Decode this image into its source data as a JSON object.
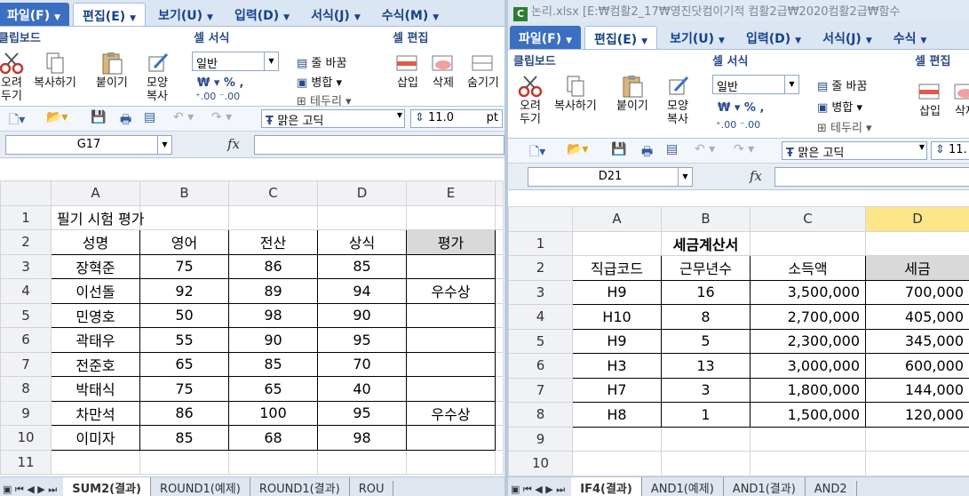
{
  "left": {
    "menus": [
      {
        "label": "파일(F)",
        "type": "file"
      },
      {
        "label": "편집(E)",
        "type": "active"
      },
      {
        "label": "보기(U)",
        "type": "normal"
      },
      {
        "label": "입력(D)",
        "type": "normal"
      },
      {
        "label": "서식(J)",
        "type": "normal"
      },
      {
        "label": "수식(M)",
        "type": "normal"
      }
    ],
    "ribbon": {
      "clipboard": "클립보드",
      "cell_format": "셀 서식",
      "cell_edit": "셀 편집",
      "cut": "오려\n두기",
      "copy": "복사하기",
      "paste": "붙이기",
      "format_painter": "모양\n복사",
      "number_format": "일반",
      "wrap": "줄 바꿈",
      "merge": "병합",
      "border": "테두리",
      "insert": "삽입",
      "delete": "삭제",
      "hide": "숨기기"
    },
    "font_name": "맑은 고딕",
    "font_size": "11.0",
    "font_unit": "pt",
    "name_box": "G17",
    "columns": [
      "A",
      "B",
      "C",
      "D",
      "E"
    ],
    "rows": [
      {
        "n": "1",
        "cells": [
          "필기 시험 평가",
          "",
          "",
          "",
          ""
        ]
      },
      {
        "n": "2",
        "cells": [
          "성명",
          "영어",
          "전산",
          "상식",
          "평가"
        ]
      },
      {
        "n": "3",
        "cells": [
          "장혁준",
          "75",
          "86",
          "85",
          ""
        ]
      },
      {
        "n": "4",
        "cells": [
          "이선돌",
          "92",
          "89",
          "94",
          "우수상"
        ]
      },
      {
        "n": "5",
        "cells": [
          "민영호",
          "50",
          "98",
          "90",
          ""
        ]
      },
      {
        "n": "6",
        "cells": [
          "곽태우",
          "55",
          "90",
          "95",
          ""
        ]
      },
      {
        "n": "7",
        "cells": [
          "전준호",
          "65",
          "85",
          "70",
          ""
        ]
      },
      {
        "n": "8",
        "cells": [
          "박태식",
          "75",
          "65",
          "40",
          ""
        ]
      },
      {
        "n": "9",
        "cells": [
          "차만석",
          "86",
          "100",
          "95",
          "우수상"
        ]
      },
      {
        "n": "10",
        "cells": [
          "이미자",
          "85",
          "68",
          "98",
          ""
        ]
      },
      {
        "n": "11",
        "cells": [
          "",
          "",
          "",
          "",
          ""
        ]
      }
    ],
    "sheet_tabs": [
      "SUM2(결과)",
      "ROUND1(예제)",
      "ROUND1(결과)",
      "ROU"
    ],
    "active_tab": 0
  },
  "right": {
    "title": "논리.xlsx [E:₩컴활2_17₩영진닷컴이기적 컴활2급₩2020컴활2급₩함수",
    "menus": [
      {
        "label": "파일(F)",
        "type": "file"
      },
      {
        "label": "편집(E)",
        "type": "active"
      },
      {
        "label": "보기(U)",
        "type": "normal"
      },
      {
        "label": "입력(D)",
        "type": "normal"
      },
      {
        "label": "서식(J)",
        "type": "normal"
      },
      {
        "label": "수식",
        "type": "normal"
      }
    ],
    "ribbon": {
      "clipboard": "클립보드",
      "cell_format": "셀 서식",
      "cell_edit": "셀 편집",
      "cut": "오려\n두기",
      "copy": "복사하기",
      "paste": "붙이기",
      "format_painter": "모양\n복사",
      "number_format": "일반",
      "wrap": "줄 바꿈",
      "merge": "병합",
      "border": "테두리",
      "insert": "삽입",
      "delete": "삭제"
    },
    "font_name": "맑은 고딕",
    "font_size": "11.",
    "name_box": "D21",
    "columns": [
      "A",
      "B",
      "C",
      "D"
    ],
    "rows": [
      {
        "n": "1",
        "cells": [
          "",
          "세금계산서",
          "",
          ""
        ]
      },
      {
        "n": "2",
        "cells": [
          "직급코드",
          "근무년수",
          "소득액",
          "세금"
        ]
      },
      {
        "n": "3",
        "cells": [
          "H9",
          "16",
          "3,500,000",
          "700,000"
        ]
      },
      {
        "n": "4",
        "cells": [
          "H10",
          "8",
          "2,700,000",
          "405,000"
        ]
      },
      {
        "n": "5",
        "cells": [
          "H9",
          "5",
          "2,300,000",
          "345,000"
        ]
      },
      {
        "n": "6",
        "cells": [
          "H3",
          "13",
          "3,000,000",
          "600,000"
        ]
      },
      {
        "n": "7",
        "cells": [
          "H7",
          "3",
          "1,800,000",
          "144,000"
        ]
      },
      {
        "n": "8",
        "cells": [
          "H8",
          "1",
          "1,500,000",
          "120,000"
        ]
      },
      {
        "n": "9",
        "cells": [
          "",
          "",
          "",
          ""
        ]
      },
      {
        "n": "10",
        "cells": [
          "",
          "",
          "",
          ""
        ]
      }
    ],
    "sheet_tabs": [
      "IF4(결과)",
      "AND1(예제)",
      "AND1(결과)",
      "AND2"
    ],
    "active_tab": 0
  }
}
